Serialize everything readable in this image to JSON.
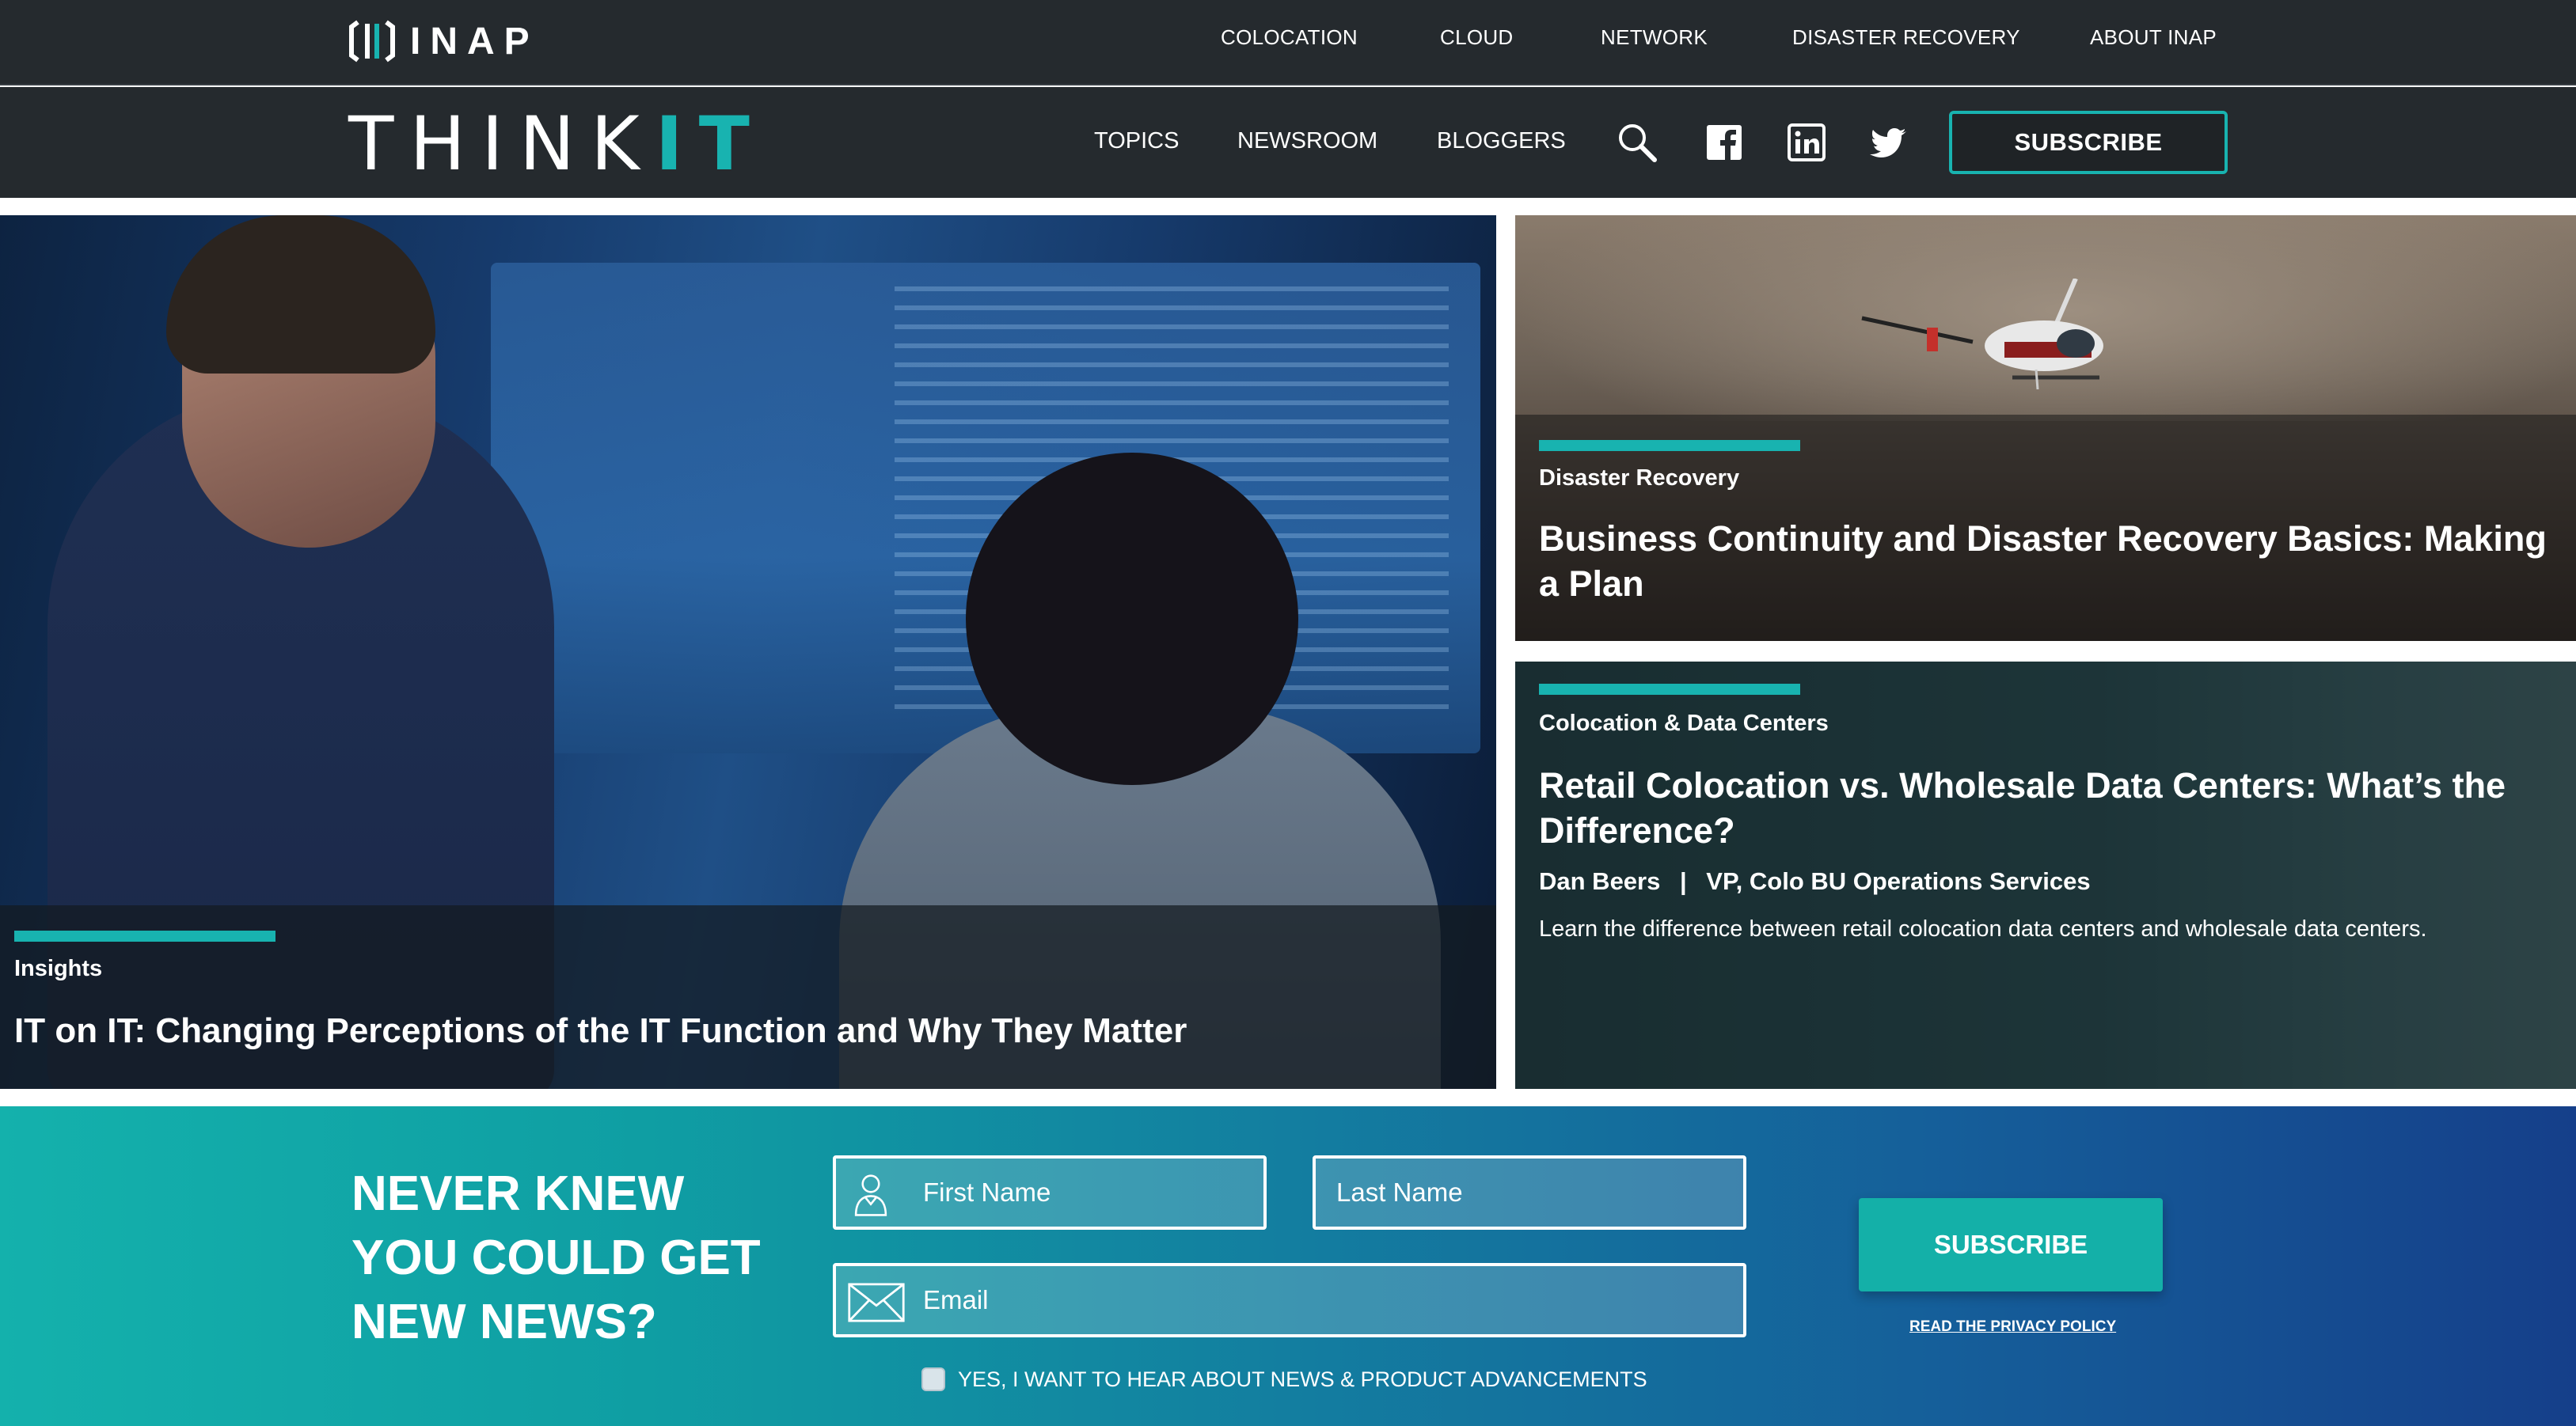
{
  "brand": {
    "logo_text": "INAP",
    "site_name_think": "THINK",
    "site_name_it": "IT",
    "accent_color": "#18b3b0"
  },
  "top_nav": {
    "items": [
      {
        "label": "COLOCATION"
      },
      {
        "label": "CLOUD"
      },
      {
        "label": "NETWORK"
      },
      {
        "label": "DISASTER RECOVERY"
      },
      {
        "label": "ABOUT INAP"
      }
    ]
  },
  "main_nav": {
    "items": [
      {
        "label": "TOPICS"
      },
      {
        "label": "NEWSROOM"
      },
      {
        "label": "BLOGGERS"
      }
    ],
    "icons": [
      "search-icon",
      "facebook-icon",
      "linkedin-icon",
      "twitter-icon"
    ],
    "subscribe_label": "SUBSCRIBE"
  },
  "hero": {
    "category": "Insights",
    "title": "IT on IT: Changing Perceptions of the IT Function and Why They Matter"
  },
  "cards": [
    {
      "category": "Disaster Recovery",
      "title": "Business Continuity and Disaster Recovery Basics: Making a Plan"
    },
    {
      "category": "Colocation & Data Centers",
      "title": "Retail Colocation vs. Wholesale Data Centers: What’s the Difference?",
      "author": "Dan Beers",
      "separator": "|",
      "role": "VP, Colo BU Operations Services",
      "excerpt": "Learn the difference between retail colocation data centers and wholesale data centers."
    }
  ],
  "newsletter": {
    "heading": "NEVER KNEW YOU COULD GET NEW NEWS?",
    "first_name_placeholder": "First Name",
    "last_name_placeholder": "Last Name",
    "email_placeholder": "Email",
    "subscribe_label": "SUBSCRIBE",
    "privacy_label": "READ THE PRIVACY POLICY",
    "consent_label": "YES, I WANT TO HEAR ABOUT NEWS & PRODUCT ADVANCEMENTS"
  }
}
